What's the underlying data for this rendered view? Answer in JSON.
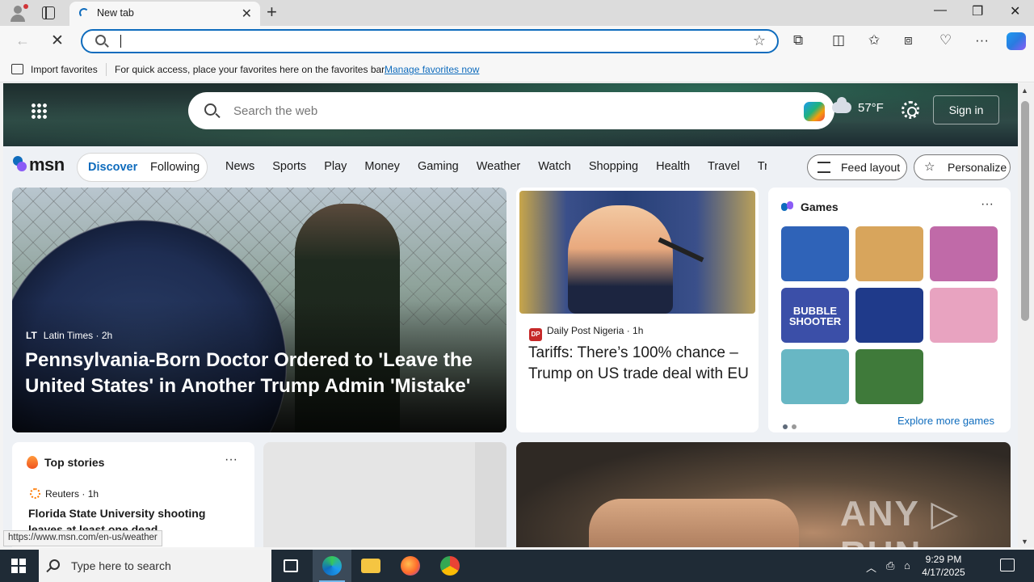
{
  "browser": {
    "tab": {
      "title": "New tab",
      "close": "✕"
    },
    "new_tab": "+",
    "window": {
      "minimize": "—",
      "restore": "❐",
      "close": "✕"
    },
    "address": {
      "value": "",
      "placeholder": ""
    },
    "favorites_bar": {
      "import_label": "Import favorites",
      "hint": "For quick access, place your favorites here on the favorites bar.",
      "manage_link": "Manage favorites now"
    },
    "status_url": "https://www.msn.com/en-us/weather"
  },
  "msn": {
    "search_placeholder": "Search the web",
    "weather": {
      "temp": "57°F",
      "icon": "cloudy-icon"
    },
    "sign_in": "Sign in",
    "logo": "msn",
    "tabs": [
      "Discover",
      "Following"
    ],
    "categories": [
      "News",
      "Sports",
      "Play",
      "Money",
      "Gaming",
      "Weather",
      "Watch",
      "Shopping",
      "Health",
      "Travel",
      "Tra"
    ],
    "feed_layout": "Feed layout",
    "personalize": "Personalize",
    "hero": {
      "source_abbr": "LT",
      "source": "Latin Times",
      "age": "2h",
      "headline": "Pennsylvania-Born Doctor Ordered to 'Leave the United States' in Another Trump Admin 'Mistake'"
    },
    "story2": {
      "source_abbr": "DP",
      "source": "Daily Post Nigeria",
      "age": "1h",
      "headline": "Tariffs: There’s 100% chance – Trump on US trade deal with EU"
    },
    "games": {
      "title": "Games",
      "more": "···",
      "tiles": [
        {
          "name": "gem-match",
          "color": "#2f63b8",
          "text": ""
        },
        {
          "name": "wood-screw",
          "color": "#d8a55c",
          "text": ""
        },
        {
          "name": "makeup",
          "color": "#c06aa8",
          "text": ""
        },
        {
          "name": "bubble-shooter",
          "color": "#3b4fa8",
          "text": "BUBBLE SHOOTER"
        },
        {
          "name": "block-puzzle",
          "color": "#1f3a8a",
          "text": ""
        },
        {
          "name": "dress-up",
          "color": "#e8a3c0",
          "text": ""
        },
        {
          "name": "hospital",
          "color": "#68b7c4",
          "text": ""
        },
        {
          "name": "mahjong",
          "color": "#3f7a3a",
          "text": ""
        }
      ],
      "explore": "Explore more games"
    },
    "top_stories": {
      "title": "Top stories",
      "more": "···",
      "source": "Reuters",
      "age": "1h",
      "headline": "Florida State University shooting leaves at least one dead"
    },
    "watermark": "ANY RUN"
  },
  "taskbar": {
    "search_placeholder": "Type here to search",
    "time": "9:29 PM",
    "date": "4/17/2025"
  }
}
